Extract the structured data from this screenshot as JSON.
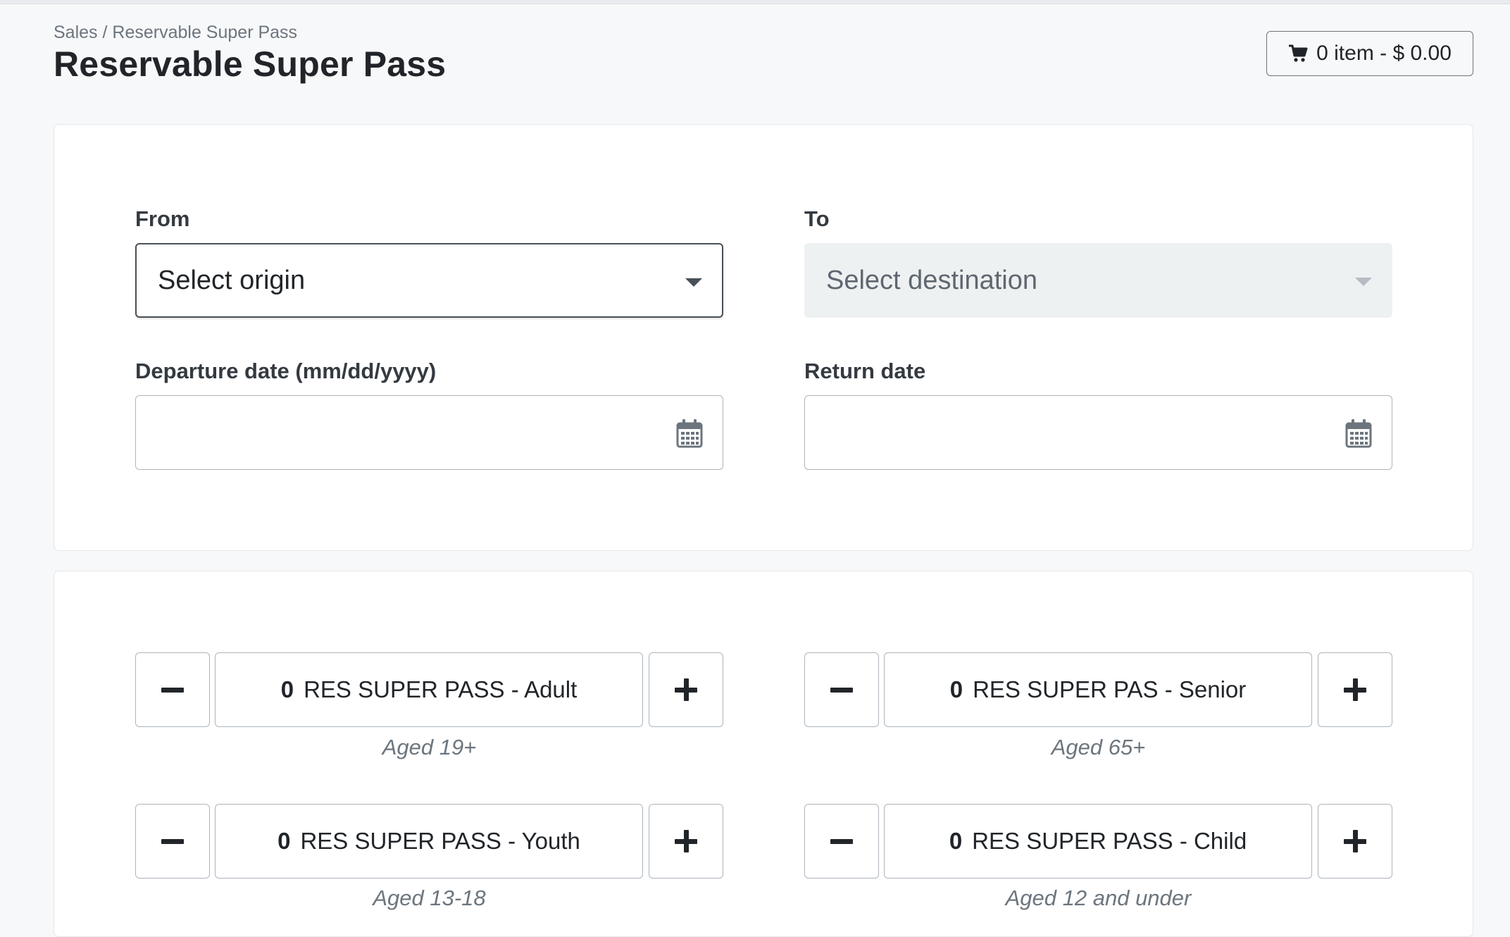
{
  "breadcrumb": {
    "root": "Sales",
    "separator": "/",
    "current": "Reservable Super Pass"
  },
  "page": {
    "title": "Reservable Super Pass"
  },
  "cart": {
    "label": "0 item - $ 0.00",
    "icon": "cart-icon"
  },
  "trip": {
    "from_label": "From",
    "from_placeholder": "Select origin",
    "to_label": "To",
    "to_placeholder": "Select destination",
    "departure_label": "Departure date (mm/dd/yyyy)",
    "departure_value": "",
    "return_label": "Return date",
    "return_value": ""
  },
  "passes": [
    {
      "quantity": "0",
      "name": "RES SUPER PASS - Adult",
      "age": "Aged 19+"
    },
    {
      "quantity": "0",
      "name": "RES SUPER PAS - Senior",
      "age": "Aged 65+"
    },
    {
      "quantity": "0",
      "name": "RES SUPER PASS - Youth",
      "age": "Aged 13-18"
    },
    {
      "quantity": "0",
      "name": "RES SUPER PASS - Child",
      "age": "Aged 12 and under"
    }
  ]
}
